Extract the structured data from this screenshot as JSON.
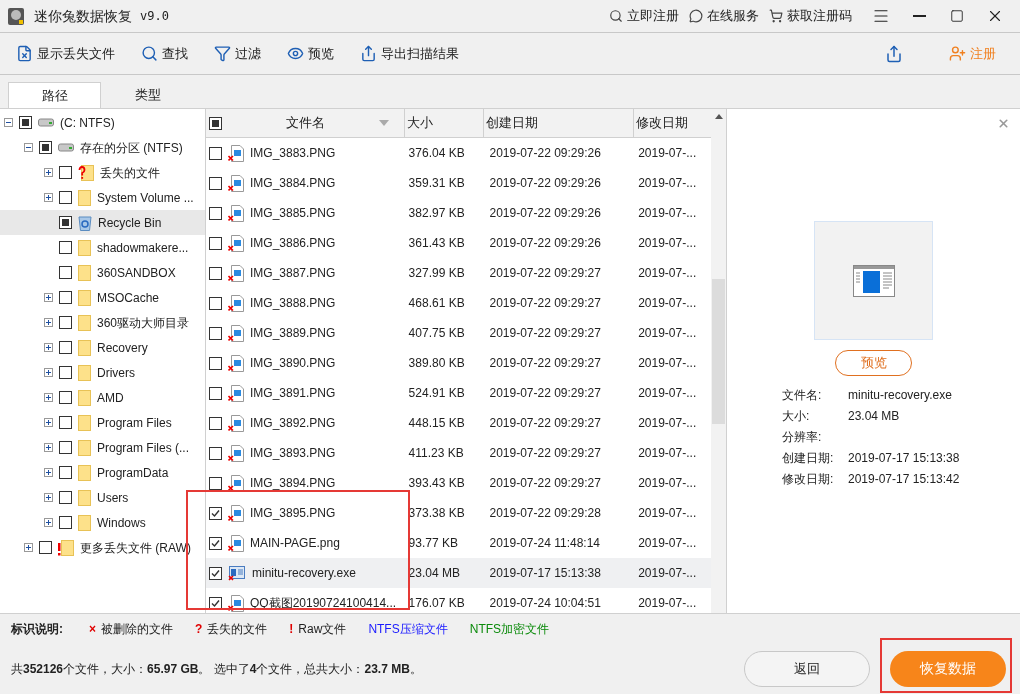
{
  "window": {
    "title": "迷你兔数据恢复",
    "version": "v9.0",
    "links": [
      "立即注册",
      "在线服务",
      "获取注册码"
    ]
  },
  "toolbar": {
    "items": [
      "显示丢失文件",
      "查找",
      "过滤",
      "预览",
      "导出扫描结果"
    ],
    "register": "注册"
  },
  "tabs": [
    {
      "label": "路径",
      "selected": true
    },
    {
      "label": "类型",
      "selected": false
    }
  ],
  "tree": [
    {
      "label": "(C: NTFS)",
      "kind": "drive",
      "expanded": true,
      "checked": true,
      "selected": false,
      "children": [
        {
          "label": "存在的分区 (NTFS)",
          "kind": "drive",
          "expanded": true,
          "checked": true,
          "selected": false,
          "children": [
            {
              "label": "丢失的文件",
              "kind": "lost",
              "expanded": false,
              "checked": false,
              "selected": false
            },
            {
              "label": "System Volume ...",
              "kind": "folder",
              "expanded": false,
              "checked": false,
              "selected": false
            },
            {
              "label": "Recycle Bin",
              "kind": "recycle",
              "checked": true,
              "selected": true
            },
            {
              "label": "shadowmakere...",
              "kind": "folder",
              "checked": false,
              "selected": false
            },
            {
              "label": "360SANDBOX",
              "kind": "folder",
              "checked": false,
              "selected": false
            },
            {
              "label": "MSOCache",
              "kind": "folder",
              "expanded": false,
              "checked": false,
              "selected": false
            },
            {
              "label": "360驱动大师目录",
              "kind": "folder",
              "expanded": false,
              "checked": false,
              "selected": false
            },
            {
              "label": "Recovery",
              "kind": "folder",
              "expanded": false,
              "checked": false,
              "selected": false
            },
            {
              "label": "Drivers",
              "kind": "folder",
              "expanded": false,
              "checked": false,
              "selected": false
            },
            {
              "label": "AMD",
              "kind": "folder",
              "expanded": false,
              "checked": false,
              "selected": false
            },
            {
              "label": "Program Files",
              "kind": "folder",
              "expanded": false,
              "checked": false,
              "selected": false
            },
            {
              "label": "Program Files (...",
              "kind": "folder",
              "expanded": false,
              "checked": false,
              "selected": false
            },
            {
              "label": "ProgramData",
              "kind": "folder",
              "expanded": false,
              "checked": false,
              "selected": false
            },
            {
              "label": "Users",
              "kind": "folder",
              "expanded": false,
              "checked": false,
              "selected": false
            },
            {
              "label": "Windows",
              "kind": "folder",
              "expanded": false,
              "checked": false,
              "selected": false
            }
          ]
        },
        {
          "label": "更多丢失文件 (RAW)",
          "kind": "raw",
          "expanded": false,
          "checked": false,
          "selected": false
        }
      ]
    }
  ],
  "table": {
    "header_checked": true,
    "columns": [
      "文件名",
      "大小",
      "创建日期",
      "修改日期"
    ],
    "rows": [
      {
        "kind": "image",
        "checked": false,
        "selected": false,
        "name": "IMG_3883.PNG",
        "size": "376.04 KB",
        "created": "2019-07-22 09:29:26",
        "modified": "2019-07-..."
      },
      {
        "kind": "image",
        "checked": false,
        "selected": false,
        "name": "IMG_3884.PNG",
        "size": "359.31 KB",
        "created": "2019-07-22 09:29:26",
        "modified": "2019-07-..."
      },
      {
        "kind": "image",
        "checked": false,
        "selected": false,
        "name": "IMG_3885.PNG",
        "size": "382.97 KB",
        "created": "2019-07-22 09:29:26",
        "modified": "2019-07-..."
      },
      {
        "kind": "image",
        "checked": false,
        "selected": false,
        "name": "IMG_3886.PNG",
        "size": "361.43 KB",
        "created": "2019-07-22 09:29:26",
        "modified": "2019-07-..."
      },
      {
        "kind": "image",
        "checked": false,
        "selected": false,
        "name": "IMG_3887.PNG",
        "size": "327.99 KB",
        "created": "2019-07-22 09:29:27",
        "modified": "2019-07-..."
      },
      {
        "kind": "image",
        "checked": false,
        "selected": false,
        "name": "IMG_3888.PNG",
        "size": "468.61 KB",
        "created": "2019-07-22 09:29:27",
        "modified": "2019-07-..."
      },
      {
        "kind": "image",
        "checked": false,
        "selected": false,
        "name": "IMG_3889.PNG",
        "size": "407.75 KB",
        "created": "2019-07-22 09:29:27",
        "modified": "2019-07-..."
      },
      {
        "kind": "image",
        "checked": false,
        "selected": false,
        "name": "IMG_3890.PNG",
        "size": "389.80 KB",
        "created": "2019-07-22 09:29:27",
        "modified": "2019-07-..."
      },
      {
        "kind": "image",
        "checked": false,
        "selected": false,
        "name": "IMG_3891.PNG",
        "size": "524.91 KB",
        "created": "2019-07-22 09:29:27",
        "modified": "2019-07-..."
      },
      {
        "kind": "image",
        "checked": false,
        "selected": false,
        "name": "IMG_3892.PNG",
        "size": "448.15 KB",
        "created": "2019-07-22 09:29:27",
        "modified": "2019-07-..."
      },
      {
        "kind": "image",
        "checked": false,
        "selected": false,
        "name": "IMG_3893.PNG",
        "size": "411.23 KB",
        "created": "2019-07-22 09:29:27",
        "modified": "2019-07-..."
      },
      {
        "kind": "image",
        "checked": false,
        "selected": false,
        "name": "IMG_3894.PNG",
        "size": "393.43 KB",
        "created": "2019-07-22 09:29:27",
        "modified": "2019-07-..."
      },
      {
        "kind": "image",
        "checked": true,
        "selected": false,
        "name": "IMG_3895.PNG",
        "size": "373.38 KB",
        "created": "2019-07-22 09:29:28",
        "modified": "2019-07-..."
      },
      {
        "kind": "image",
        "checked": true,
        "selected": false,
        "name": "MAIN-PAGE.png",
        "size": "93.77 KB",
        "created": "2019-07-24 11:48:14",
        "modified": "2019-07-..."
      },
      {
        "kind": "exe",
        "checked": true,
        "selected": true,
        "name": "minitu-recovery.exe",
        "size": "23.04 MB",
        "created": "2019-07-17 15:13:38",
        "modified": "2019-07-..."
      },
      {
        "kind": "image",
        "checked": true,
        "selected": false,
        "name": "QQ截图20190724100414...",
        "size": "176.07 KB",
        "created": "2019-07-24 10:04:51",
        "modified": "2019-07-..."
      }
    ]
  },
  "preview": {
    "button": "预览",
    "fields": [
      {
        "label": "文件名:",
        "value": "minitu-recovery.exe"
      },
      {
        "label": "大小:",
        "value": "23.04 MB"
      },
      {
        "label": "分辨率:"
      },
      {
        "label": "创建日期:",
        "value": "2019-07-17 15:13:38"
      },
      {
        "label": "修改日期:",
        "value": "2019-07-17 15:13:42"
      }
    ]
  },
  "legend": {
    "title": "标识说明:",
    "items": [
      {
        "mark": "×",
        "label": "被删除的文件"
      },
      {
        "mark": "?",
        "label": "丢失的文件"
      },
      {
        "mark": "!",
        "label": "Raw文件"
      },
      {
        "label": "NTFS压缩文件",
        "color": "#1a1aff"
      },
      {
        "label": "NTFS加密文件",
        "color": "#0a8a0a"
      }
    ]
  },
  "status": "共**352126**个文件，大小：**65.97 GB**。 选中了**4**个文件，总共大小：**23.7 MB**。",
  "buttons": [
    {
      "label": "返回",
      "kind": "secondary"
    },
    {
      "label": "恢复数据",
      "kind": "primary"
    }
  ]
}
